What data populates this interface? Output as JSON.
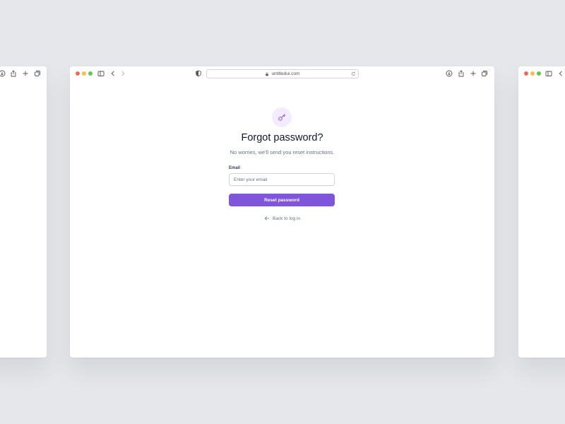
{
  "browser": {
    "url": "untitledui.com",
    "traffic_light_colors": {
      "close": "#ee6a5f",
      "minimize": "#f5bf4f",
      "zoom": "#62c554"
    }
  },
  "page": {
    "icon": "key-icon",
    "title": "Forgot password?",
    "subtitle": "No worries, we'll send you reset instructions.",
    "email_label": "Email",
    "email_placeholder": "Enter your email",
    "email_value": "",
    "submit_label": "Reset password",
    "back_label": "Back to log in"
  },
  "colors": {
    "accent": "#7f56d9",
    "icon_bg": "#f4ebff",
    "title_text": "#101828",
    "muted_text": "#667085",
    "backdrop": "#e5e7ea"
  }
}
